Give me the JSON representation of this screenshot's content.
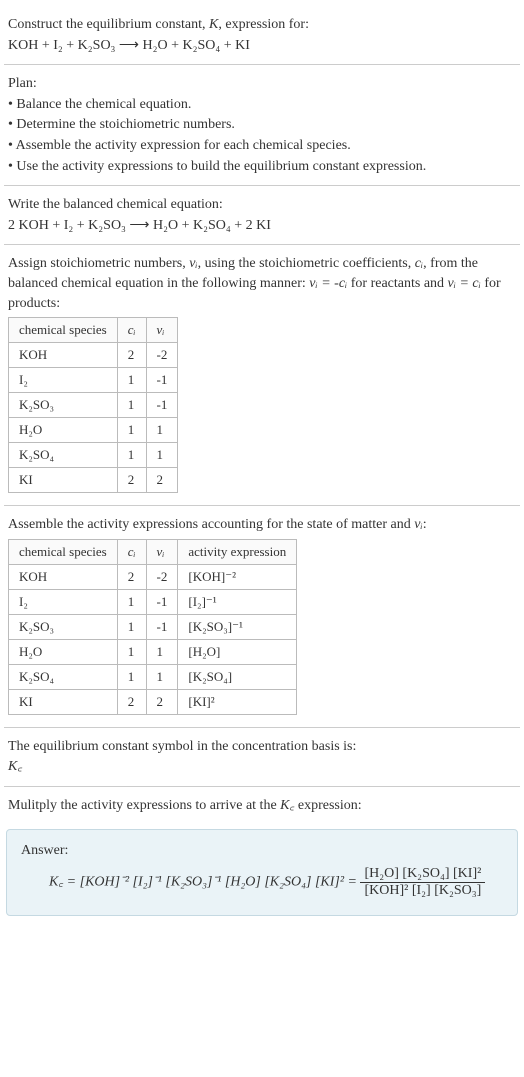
{
  "intro": {
    "line1": "Construct the equilibrium constant, ",
    "k": "K",
    "line1b": ", expression for:",
    "equation": "KOH + I₂ + K₂SO₃  ⟶  H₂O + K₂SO₄ + KI"
  },
  "plan": {
    "heading": "Plan:",
    "b1": "• Balance the chemical equation.",
    "b2": "• Determine the stoichiometric numbers.",
    "b3": "• Assemble the activity expression for each chemical species.",
    "b4": "• Use the activity expressions to build the equilibrium constant expression."
  },
  "balanced": {
    "heading": "Write the balanced chemical equation:",
    "equation": "2 KOH + I₂ + K₂SO₃  ⟶  H₂O + K₂SO₄ + 2 KI"
  },
  "stoich": {
    "intro_a": "Assign stoichiometric numbers, ",
    "nu": "νᵢ",
    "intro_b": ", using the stoichiometric coefficients, ",
    "ci": "cᵢ",
    "intro_c": ", from the balanced chemical equation in the following manner: ",
    "rel1": "νᵢ = -cᵢ",
    "intro_d": " for reactants and ",
    "rel2": "νᵢ = cᵢ",
    "intro_e": " for products:",
    "headers": {
      "h1": "chemical species",
      "h2": "cᵢ",
      "h3": "νᵢ"
    },
    "rows": [
      {
        "sp": "KOH",
        "c": "2",
        "nu": "-2"
      },
      {
        "sp": "I₂",
        "c": "1",
        "nu": "-1"
      },
      {
        "sp": "K₂SO₃",
        "c": "1",
        "nu": "-1"
      },
      {
        "sp": "H₂O",
        "c": "1",
        "nu": "1"
      },
      {
        "sp": "K₂SO₄",
        "c": "1",
        "nu": "1"
      },
      {
        "sp": "KI",
        "c": "2",
        "nu": "2"
      }
    ]
  },
  "activity": {
    "intro_a": "Assemble the activity expressions accounting for the state of matter and ",
    "nu": "νᵢ",
    "intro_b": ":",
    "headers": {
      "h1": "chemical species",
      "h2": "cᵢ",
      "h3": "νᵢ",
      "h4": "activity expression"
    },
    "rows": [
      {
        "sp": "KOH",
        "c": "2",
        "nu": "-2",
        "ae": "[KOH]⁻²"
      },
      {
        "sp": "I₂",
        "c": "1",
        "nu": "-1",
        "ae": "[I₂]⁻¹"
      },
      {
        "sp": "K₂SO₃",
        "c": "1",
        "nu": "-1",
        "ae": "[K₂SO₃]⁻¹"
      },
      {
        "sp": "H₂O",
        "c": "1",
        "nu": "1",
        "ae": "[H₂O]"
      },
      {
        "sp": "K₂SO₄",
        "c": "1",
        "nu": "1",
        "ae": "[K₂SO₄]"
      },
      {
        "sp": "KI",
        "c": "2",
        "nu": "2",
        "ae": "[KI]²"
      }
    ]
  },
  "symbol": {
    "line": "The equilibrium constant symbol in the concentration basis is:",
    "kc": "K꜀"
  },
  "multiply": {
    "line_a": "Mulitply the activity expressions to arrive at the ",
    "kc": "K꜀",
    "line_b": " expression:"
  },
  "answer": {
    "label": "Answer:",
    "lhs": "K꜀ = [KOH]⁻² [I₂]⁻¹ [K₂SO₃]⁻¹ [H₂O] [K₂SO₄] [KI]² = ",
    "num": "[H₂O] [K₂SO₄] [KI]²",
    "den": "[KOH]² [I₂] [K₂SO₃]"
  }
}
